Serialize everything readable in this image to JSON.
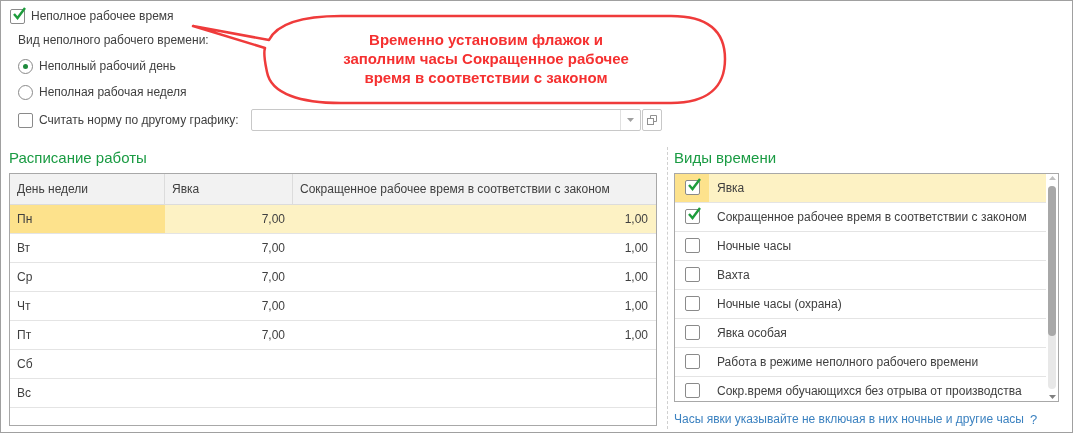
{
  "partial_time": {
    "label": "Неполное рабочее время",
    "checked": true
  },
  "partial_type": {
    "label": "Вид неполного рабочего времени:",
    "options": [
      {
        "label": "Неполный рабочий день",
        "selected": true
      },
      {
        "label": "Неполная рабочая неделя",
        "selected": false
      }
    ]
  },
  "other_schedule": {
    "label": "Считать норму по другому графику:",
    "checked": false
  },
  "callout": {
    "text": "Временно установим флажок и заполним часы Сокращенное рабочее время в соответствии с законом"
  },
  "schedule": {
    "title": "Расписание работы",
    "columns": [
      "День недели",
      "Явка",
      "Сокращенное рабочее время в соответствии с законом"
    ],
    "rows": [
      {
        "day": "Пн",
        "attendance": "7,00",
        "reduced": "1,00",
        "selected": true
      },
      {
        "day": "Вт",
        "attendance": "7,00",
        "reduced": "1,00",
        "selected": false
      },
      {
        "day": "Ср",
        "attendance": "7,00",
        "reduced": "1,00",
        "selected": false
      },
      {
        "day": "Чт",
        "attendance": "7,00",
        "reduced": "1,00",
        "selected": false
      },
      {
        "day": "Пт",
        "attendance": "7,00",
        "reduced": "1,00",
        "selected": false
      },
      {
        "day": "Сб",
        "selected": false
      },
      {
        "day": "Вс",
        "selected": false
      }
    ]
  },
  "time_types": {
    "title": "Виды времени",
    "items": [
      {
        "label": "Явка",
        "checked": true,
        "selected": true
      },
      {
        "label": "Сокращенное рабочее время в соответствии с законом",
        "checked": true,
        "selected": false
      },
      {
        "label": "Ночные часы",
        "checked": false,
        "selected": false
      },
      {
        "label": "Вахта",
        "checked": false,
        "selected": false
      },
      {
        "label": "Ночные часы (охрана)",
        "checked": false,
        "selected": false
      },
      {
        "label": "Явка особая",
        "checked": false,
        "selected": false
      },
      {
        "label": "Работа в режиме неполного рабочего времени",
        "checked": false,
        "selected": false
      },
      {
        "label": "Сокр.время обучающихся без отрыва от производства",
        "checked": false,
        "selected": false
      }
    ]
  },
  "hint": {
    "text": "Часы явки указывайте не включая в них ночные и другие часы",
    "help": "?"
  }
}
